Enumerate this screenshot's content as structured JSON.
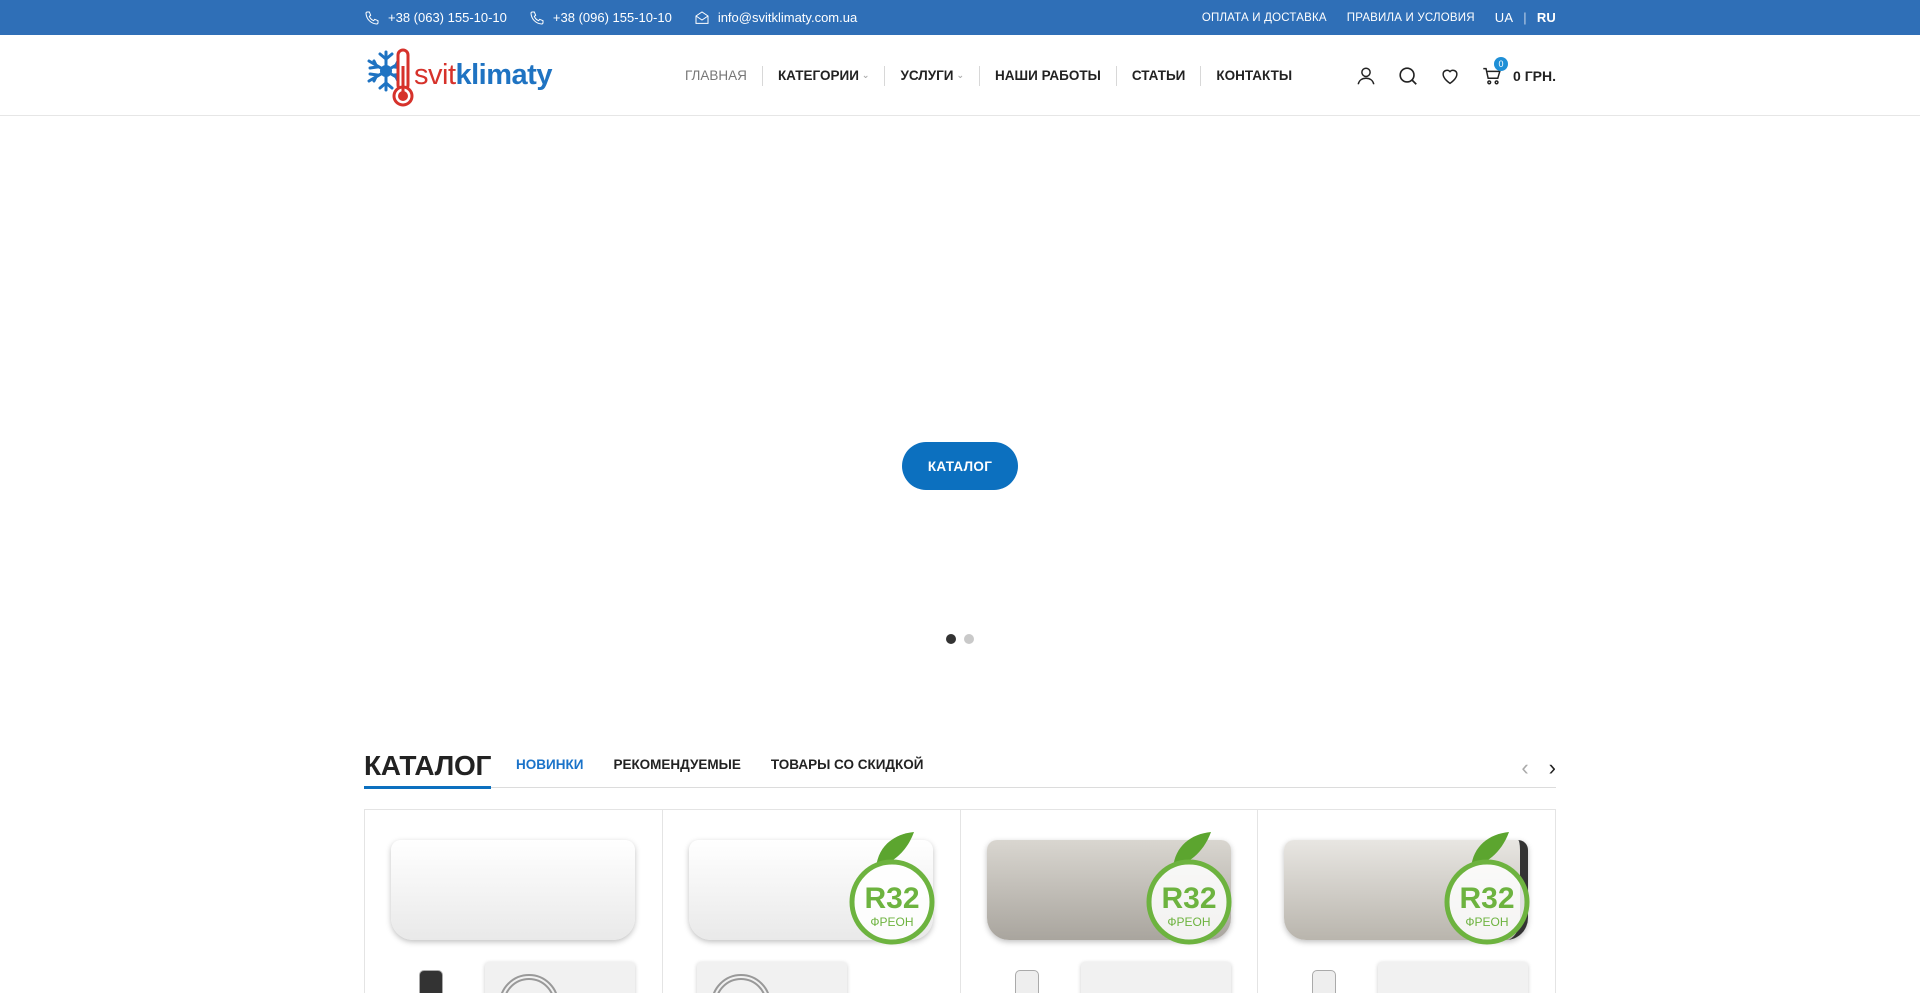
{
  "topbar": {
    "phone1": "+38 (063) 155-10-10",
    "phone2": "+38 (096) 155-10-10",
    "email": "info@svitklimaty.com.ua",
    "payment_link": "ОПЛАТА И ДОСТАВКА",
    "terms_link": "ПРАВИЛА И УСЛОВИЯ",
    "lang_ua": "UA",
    "lang_sep": "|",
    "lang_ru": "RU",
    "active_lang": "RU",
    "bg_color": "#2f6fb7"
  },
  "logo": {
    "part1": "svit",
    "part2": "klimaty"
  },
  "nav": {
    "items": [
      {
        "label": "ГЛАВНАЯ"
      },
      {
        "label": "КАТЕГОРИИ",
        "chevron": "⌄"
      },
      {
        "label": "УСЛУГИ",
        "chevron": "⌄"
      },
      {
        "label": "НАШИ РАБОТЫ"
      },
      {
        "label": "СТАТЬИ"
      },
      {
        "label": "КОНТАКТЫ"
      }
    ]
  },
  "header_icons": [
    "user-icon",
    "search-icon",
    "heart-icon",
    "cart-icon"
  ],
  "cart": {
    "count": "0",
    "total": "0 ГРН."
  },
  "hero": {
    "button_label": "КАТАЛОГ",
    "slides_total": 2,
    "active_slide": 1,
    "accent": "#0c70bf"
  },
  "catalog": {
    "title": "КАТАЛОГ",
    "tabs": [
      "НОВИНКИ",
      "РЕКОМЕНДУЕМЫЕ",
      "ТОВАРЫ СО СКИДКОЙ"
    ],
    "active_tab": "НОВИНКИ",
    "prev_arrow": "‹",
    "next_arrow": "›",
    "badge_text": "R32",
    "badge_sub": "ФРЕОН"
  }
}
